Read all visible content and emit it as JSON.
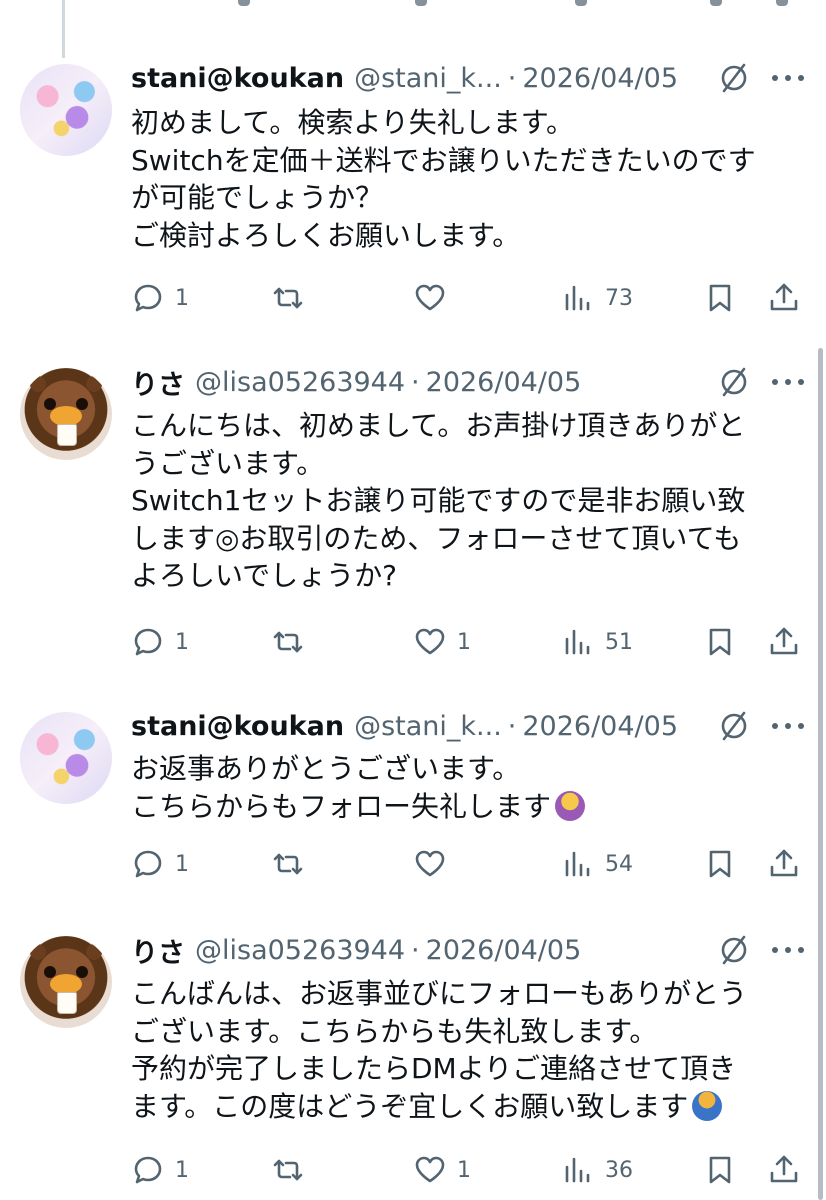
{
  "tweets": [
    {
      "author": "stani",
      "name": "stani@koukan",
      "handle": "@stani_k...",
      "separator": "·",
      "date": "2026/04/05",
      "lines": [
        "初めまして。検索より失礼します。",
        "Switchを定価＋送料でお譲りいただきたいのです",
        "が可能でしょうか？",
        "ご検討よろしくお願いします。"
      ],
      "emoji": "",
      "reply_count": "1",
      "repost_count": "",
      "like_count": "",
      "view_count": "73"
    },
    {
      "author": "lisa",
      "name": "りさ",
      "handle": "@lisa05263944",
      "separator": "·",
      "date": "2026/04/05",
      "lines": [
        "こんにちは、初めまして。お声掛け頂きありがと",
        "うございます。",
        "Switch1セットお譲り可能ですので是非お願い致",
        "します◎お取引のため、フォローさせて頂いても",
        "よろしいでしょうか?"
      ],
      "emoji": "",
      "reply_count": "1",
      "repost_count": "",
      "like_count": "1",
      "view_count": "51"
    },
    {
      "author": "stani",
      "name": "stani@koukan",
      "handle": "@stani_k...",
      "separator": "·",
      "date": "2026/04/05",
      "lines": [
        "お返事ありがとうございます。",
        "こちらからもフォロー失礼します"
      ],
      "emoji": "person-bowing-emoji",
      "reply_count": "1",
      "repost_count": "",
      "like_count": "",
      "view_count": "54"
    },
    {
      "author": "lisa",
      "name": "りさ",
      "handle": "@lisa05263944",
      "separator": "·",
      "date": "2026/04/05",
      "lines": [
        "こんばんは、お返事並びにフォローもありがとう",
        "ございます。こちらからも失礼致します。",
        "予約が完了しましたらDMよりご連絡させて頂き",
        "ます。この度はどうぞ宜しくお願い致します"
      ],
      "emoji": "person-bowing-emoji",
      "reply_count": "1",
      "repost_count": "",
      "like_count": "1",
      "view_count": "36"
    }
  ],
  "colors": {
    "text": "#0f1419",
    "secondary": "#536471",
    "thread_line": "#cfd9de"
  },
  "icons": [
    "reply-icon",
    "repost-icon",
    "like-icon",
    "views-icon",
    "bookmark-icon",
    "share-icon",
    "grok-icon",
    "more-icon"
  ]
}
